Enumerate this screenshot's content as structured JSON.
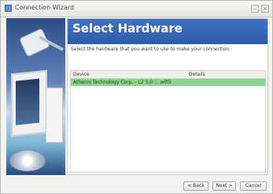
{
  "window": {
    "title": "Connection Wizard",
    "minimize_glyph": "–",
    "close_glyph": "×"
  },
  "icons": {
    "app": "wizard-app-icon",
    "minimize": "minimize-icon",
    "close": "close-icon"
  },
  "side_art": {
    "label": "illustration of computer hardware and network plug"
  },
  "header": {
    "title": "Select Hardware",
    "subtitle": "Select the hardware that you want to use to make your connection."
  },
  "table": {
    "columns": [
      "Device",
      "Details"
    ],
    "rows": [
      {
        "device": "Atheros Technology Corp. - L2 3.0 ... wifi5",
        "details": ""
      }
    ],
    "selected_row_color": "#8bd48b"
  },
  "buttons": {
    "back": "< Back",
    "next": "Next >",
    "cancel": "Cancel"
  }
}
